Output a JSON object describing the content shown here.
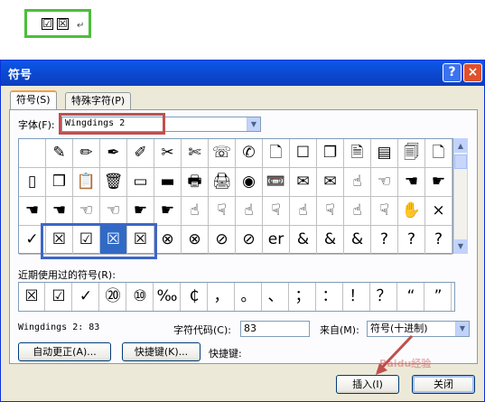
{
  "sample": {
    "glyphs": [
      "☑",
      "☒"
    ],
    "para_mark": "↵"
  },
  "dialog": {
    "title": "符号",
    "help_label": "?",
    "close_label": "×",
    "tabs": [
      {
        "label": "符号(S)",
        "active": true
      },
      {
        "label": "特殊字符(P)",
        "active": false
      }
    ],
    "font_label": "字体(F):",
    "font_value": "Wingdings 2",
    "grid": [
      [
        "",
        "✎",
        "✏",
        "✒",
        "✐",
        "✂",
        "✄",
        "☏",
        "✆",
        "🗋",
        "☐",
        "❐",
        "🗎",
        "▤",
        "🗐",
        "🗋"
      ],
      [
        "▯",
        "❒",
        "📋",
        "🗑",
        "▭",
        "▬",
        "🖶",
        "🖨",
        "◉",
        "📼",
        "✉",
        "✉",
        "☝",
        "☜",
        "☚",
        "☛"
      ],
      [
        "☚",
        "☚",
        "☜",
        "☜",
        "☛",
        "☛",
        "☝",
        "☟",
        "☝",
        "☟",
        "☝",
        "☟",
        "☝",
        "☟",
        "✋",
        "×"
      ],
      [
        "✓",
        "☒",
        "☑",
        "☒",
        "☒",
        "⊗",
        "⊗",
        "⊘",
        "⊘",
        "er",
        "&",
        "&",
        "&",
        "?",
        "?",
        "?"
      ]
    ],
    "selected_row": 3,
    "selected_col": 3,
    "recent_label": "近期使用过的符号(R):",
    "recent": [
      "☒",
      "☑",
      "✓",
      "⑳",
      "⑩",
      "‰",
      "₵",
      "，",
      "。",
      "、",
      "；",
      "：",
      "！",
      "？",
      "“",
      "”"
    ],
    "status": {
      "char_name": "Wingdings 2: 83",
      "code_label": "字符代码(C):",
      "code_value": "83",
      "from_label": "来自(M):",
      "from_value": "符号(十进制)"
    },
    "buttons": {
      "autocorrect": "自动更正(A)...",
      "shortcut_key": "快捷键(K)...",
      "shortcut_label": "快捷键:",
      "insert": "插入(I)",
      "close": "关闭"
    },
    "watermark": "Baidu经验",
    "colors": {
      "title_bar": "#0b4ad4",
      "selected": "#316ac5",
      "highlight_red": "#c0504d",
      "highlight_blue": "#3d66c9",
      "highlight_green": "#4bbf3a"
    }
  }
}
